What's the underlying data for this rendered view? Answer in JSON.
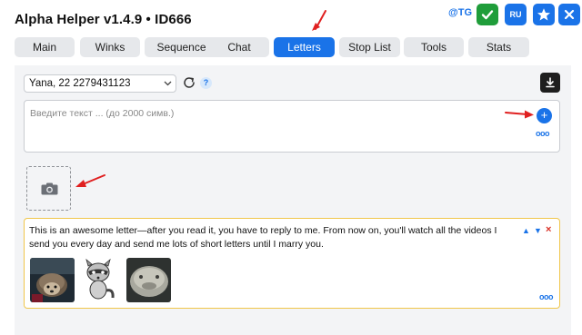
{
  "header": {
    "title": "Alpha Helper v1.4.9 • ID666",
    "tg_link": "@TG",
    "lang_button": "RU",
    "icons": [
      "check-icon",
      "star-icon",
      "close-icon"
    ]
  },
  "tabs": [
    {
      "label": "Main",
      "active": false
    },
    {
      "label": "Winks",
      "active": false
    },
    {
      "label": "Sequence",
      "active": false
    },
    {
      "label": "Chat",
      "active": false
    },
    {
      "label": "Letters",
      "active": true
    },
    {
      "label": "Stop List",
      "active": false
    },
    {
      "label": "Tools",
      "active": false
    },
    {
      "label": "Stats",
      "active": false
    }
  ],
  "contact_select": {
    "value": "Yana, 22  2279431123"
  },
  "help_label": "?",
  "compose": {
    "placeholder": "Введите текст ... (до 2000 симв.)",
    "add_label": "+",
    "more_label": "ooo"
  },
  "letter": {
    "text": "This is an awesome letter—after you read it, you have to reply to me. From now on, you'll watch all the videos I send you every day and send me lots of short letters until I marry you.",
    "up_label": "▲",
    "down_label": "▼",
    "remove_label": "×",
    "more_label": "ooo"
  },
  "colors": {
    "accent": "#1a73e8",
    "success": "#1f9d3a",
    "letter_border": "#f0c64a",
    "annotation_arrow": "#e02020"
  }
}
